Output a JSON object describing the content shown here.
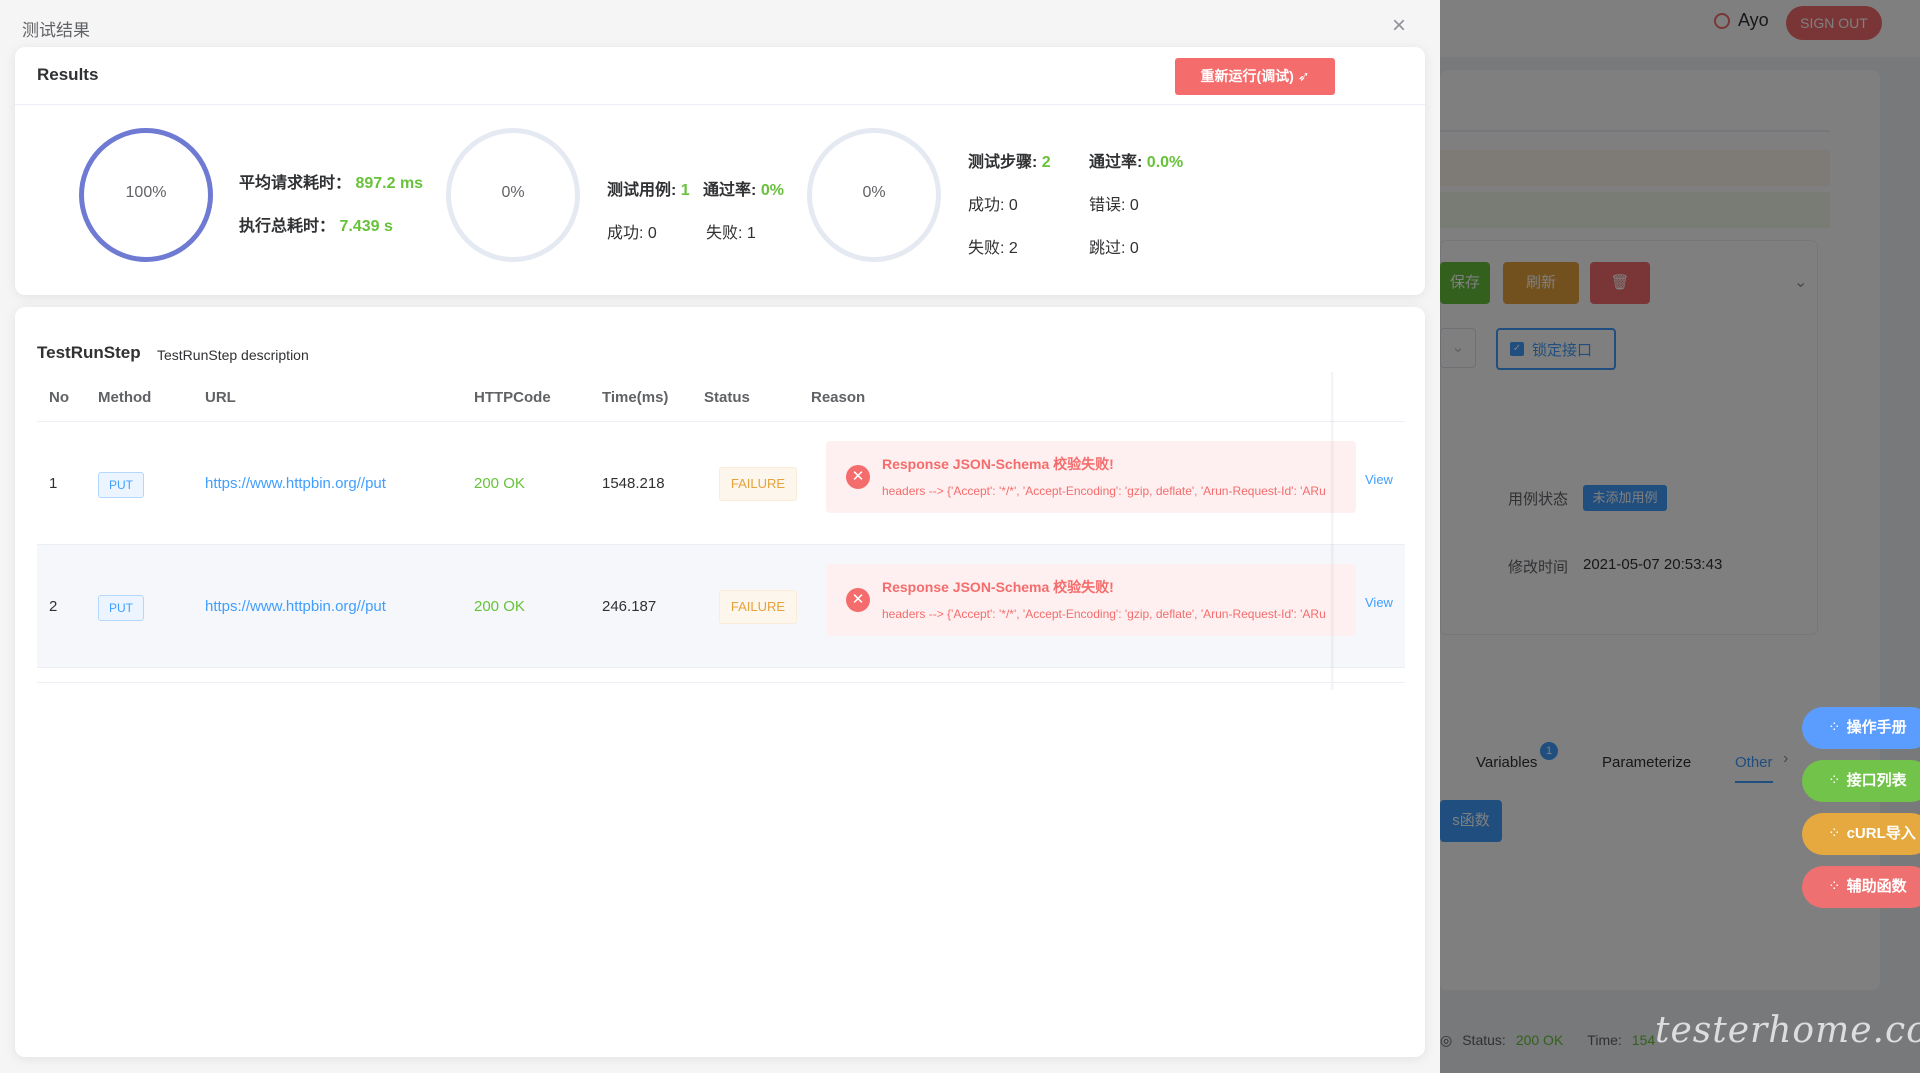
{
  "background": {
    "user_name": "Ayo",
    "signout_label": "SIGN OUT",
    "save_label": "保存",
    "refresh_label": "刷新",
    "lock_label": "锁定接口",
    "status_label": "用例状态",
    "status_value": "未添加用例",
    "modified_label": "修改时间",
    "modified_value": "2021-05-07 20:53:43",
    "tabs": [
      {
        "label": "Variables",
        "badge": "1"
      },
      {
        "label": "Parameterize"
      },
      {
        "label": "Other"
      }
    ],
    "func_btn_label": "s函数",
    "bottom_status_label": "Status:",
    "bottom_status_value": "200 OK",
    "bottom_time_label": "Time:",
    "bottom_time_value": "154"
  },
  "float_buttons": [
    {
      "label": "操作手册",
      "color": "#5b9dff"
    },
    {
      "label": "接口列表",
      "color": "#71c34a"
    },
    {
      "label": "cURL导入",
      "color": "#e5a93f"
    },
    {
      "label": "辅助函数",
      "color": "#ef7070"
    }
  ],
  "dialog": {
    "title": "测试结果",
    "close_icon": "×"
  },
  "results": {
    "title": "Results",
    "rerun_label": "重新运行(调试)",
    "ring1": {
      "value": "100%"
    },
    "ring2": {
      "value": "0%"
    },
    "ring3": {
      "value": "0%"
    },
    "avg_label": "平均请求耗时：",
    "avg_value": "897.2 ms",
    "total_label": "执行总耗时：",
    "total_value": "7.439 s",
    "case_label": "测试用例:",
    "case_value": "1",
    "case_pass_label": "通过率:",
    "case_pass_value": "0%",
    "case_success": "成功: 0",
    "case_fail": "失败: 1",
    "step_label": "测试步骤:",
    "step_value": "2",
    "step_pass_label": "通过率:",
    "step_pass_value": "0.0%",
    "step_success": "成功: 0",
    "step_error": "错误: 0",
    "step_fail": "失败: 2",
    "step_skip": "跳过: 0"
  },
  "steps": {
    "title": "TestRunStep",
    "description": "TestRunStep description",
    "columns": [
      "No",
      "Method",
      "URL",
      "HTTPCode",
      "Time(ms)",
      "Status",
      "Reason"
    ],
    "rows": [
      {
        "no": "1",
        "method": "PUT",
        "url": "https://www.httpbin.org//put",
        "http_code": "200 OK",
        "time": "1548.218",
        "status": "FAILURE",
        "reason_title": "Response JSON-Schema 校验失败!",
        "reason_detail": "headers --> {'Accept': '*/*', 'Accept-Encoding': 'gzip, deflate', 'Arun-Request-Id': 'ARu",
        "action": "View"
      },
      {
        "no": "2",
        "method": "PUT",
        "url": "https://www.httpbin.org//put",
        "http_code": "200 OK",
        "time": "246.187",
        "status": "FAILURE",
        "reason_title": "Response JSON-Schema 校验失败!",
        "reason_detail": "headers --> {'Accept': '*/*', 'Accept-Encoding': 'gzip, deflate', 'Arun-Request-Id': 'ARu",
        "action": "View"
      }
    ]
  },
  "watermark": "testerhome.com"
}
